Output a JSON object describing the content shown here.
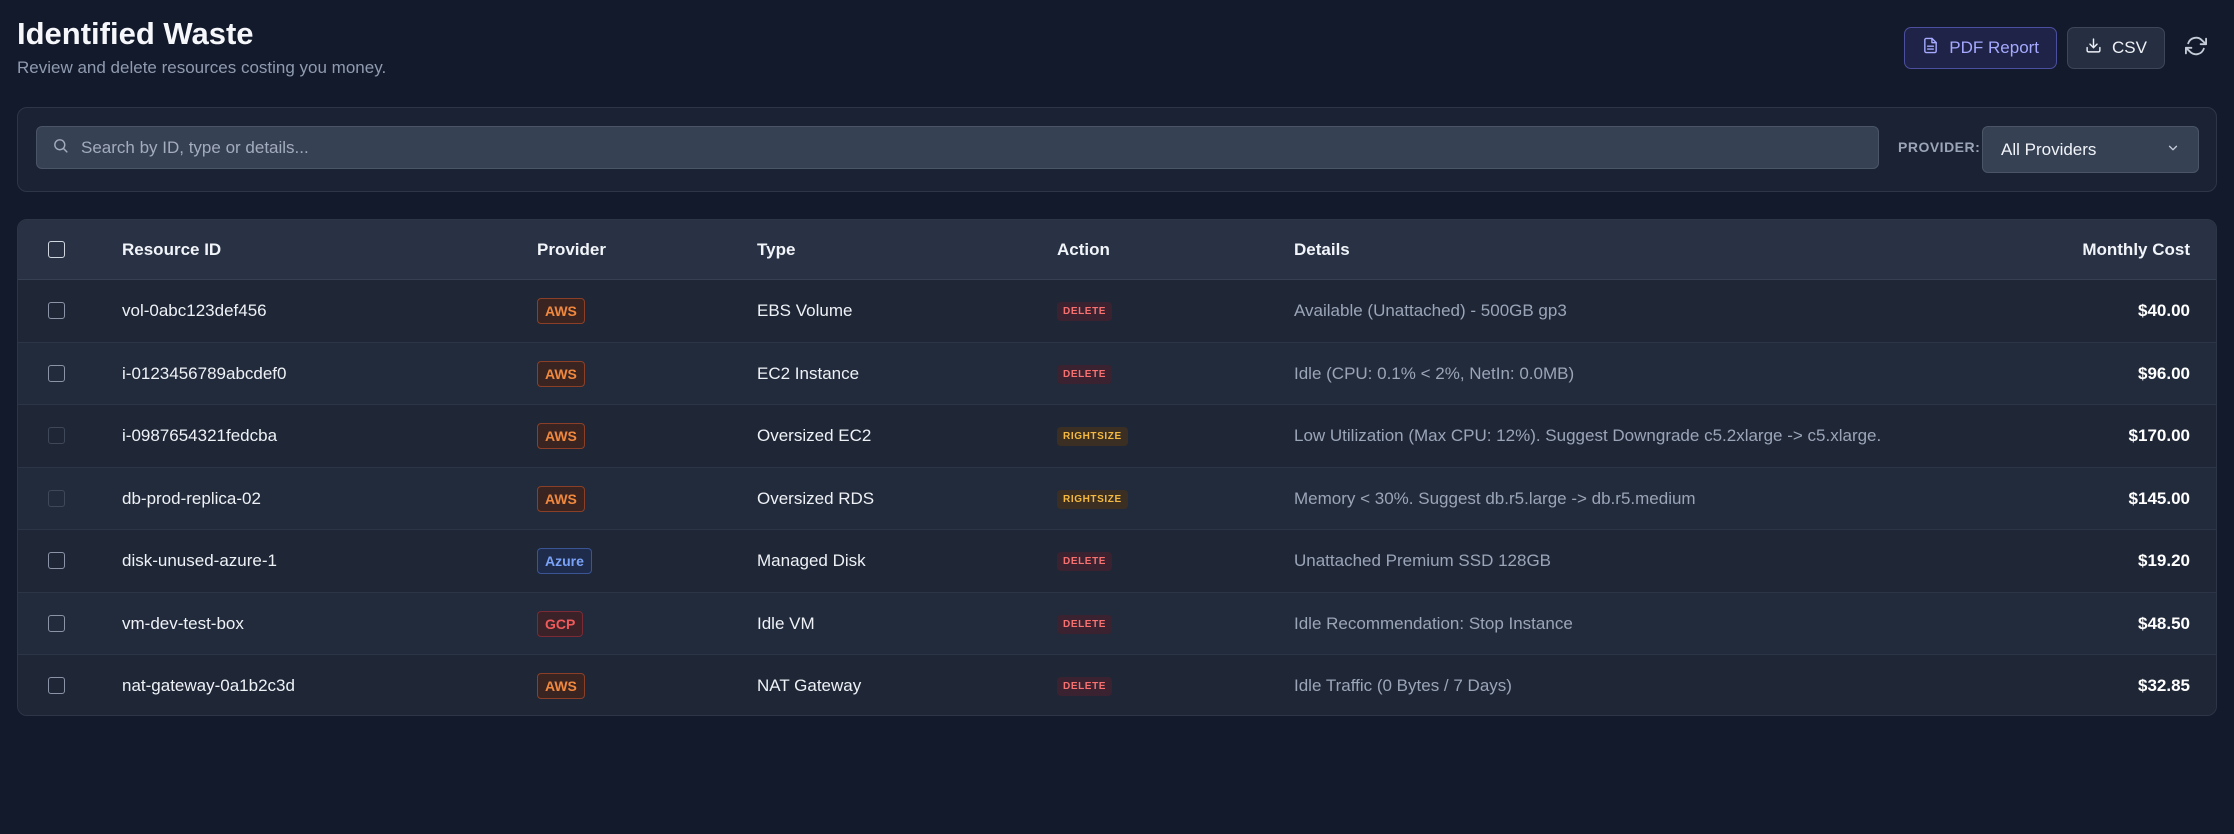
{
  "header": {
    "title": "Identified Waste",
    "subtitle": "Review and delete resources costing you money."
  },
  "toolbar": {
    "pdf_label": "PDF Report",
    "csv_label": "CSV"
  },
  "filters": {
    "search_placeholder": "Search by ID, type or details...",
    "provider_label": "PROVIDER:",
    "provider_selected": "All Providers"
  },
  "table": {
    "columns": {
      "resource_id": "Resource ID",
      "provider": "Provider",
      "type": "Type",
      "action": "Action",
      "details": "Details",
      "cost": "Monthly Cost"
    },
    "rows": [
      {
        "id": "vol-0abc123def456",
        "provider": "AWS",
        "type": "EBS Volume",
        "action": "DELETE",
        "details": "Available (Unattached) - 500GB gp3",
        "cost": "$40.00"
      },
      {
        "id": "i-0123456789abcdef0",
        "provider": "AWS",
        "type": "EC2 Instance",
        "action": "DELETE",
        "details": "Idle (CPU: 0.1% < 2%, NetIn: 0.0MB)",
        "cost": "$96.00"
      },
      {
        "id": "i-0987654321fedcba",
        "provider": "AWS",
        "type": "Oversized EC2",
        "action": "RIGHTSIZE",
        "details": "Low Utilization (Max CPU: 12%). Suggest Downgrade c5.2xlarge -> c5.xlarge.",
        "cost": "$170.00"
      },
      {
        "id": "db-prod-replica-02",
        "provider": "AWS",
        "type": "Oversized RDS",
        "action": "RIGHTSIZE",
        "details": "Memory < 30%. Suggest db.r5.large -> db.r5.medium",
        "cost": "$145.00"
      },
      {
        "id": "disk-unused-azure-1",
        "provider": "Azure",
        "type": "Managed Disk",
        "action": "DELETE",
        "details": "Unattached Premium SSD 128GB",
        "cost": "$19.20"
      },
      {
        "id": "vm-dev-test-box",
        "provider": "GCP",
        "type": "Idle VM",
        "action": "DELETE",
        "details": "Idle Recommendation: Stop Instance",
        "cost": "$48.50"
      },
      {
        "id": "nat-gateway-0a1b2c3d",
        "provider": "AWS",
        "type": "NAT Gateway",
        "action": "DELETE",
        "details": "Idle Traffic (0 Bytes / 7 Days)",
        "cost": "$32.85"
      }
    ]
  }
}
